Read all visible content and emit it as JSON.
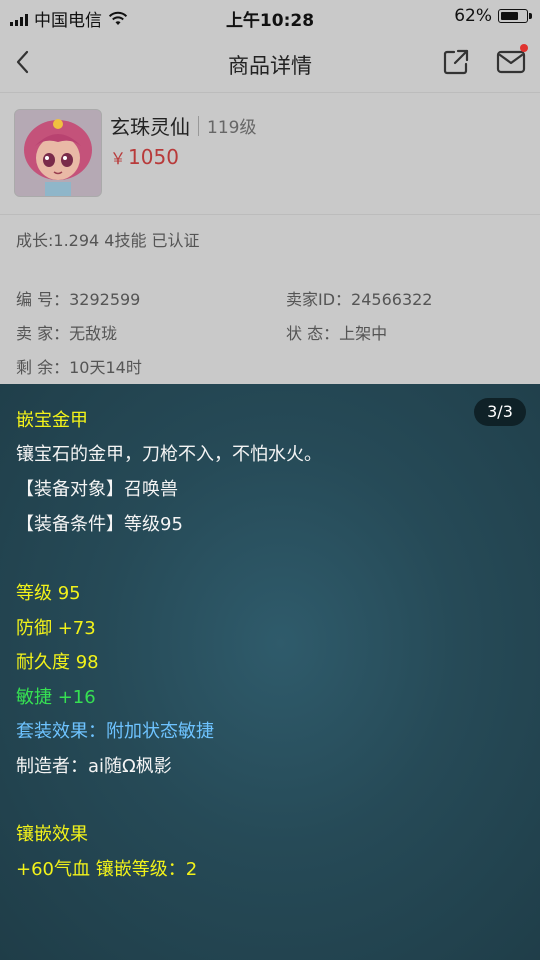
{
  "status_bar": {
    "carrier": "中国电信",
    "time": "上午10:28",
    "battery_percent": "62%",
    "battery_level": 0.62
  },
  "nav": {
    "title": "商品详情",
    "back_icon": "chevron-left-icon",
    "share_icon": "share-icon",
    "mail_icon": "mail-icon"
  },
  "product": {
    "name": "玄珠灵仙",
    "level": "119级",
    "currency": "￥",
    "price": "1050"
  },
  "growth_text": "成长:1.294 4技能 已认证",
  "info": {
    "id_label": "编 号：",
    "id_value": "3292599",
    "seller_id_label": "卖家ID：",
    "seller_id_value": "24566322",
    "seller_label": "卖 家：",
    "seller_value": "无敌珑",
    "status_label": "状 态：",
    "status_value": "上架中",
    "remaining_label": "剩 余：",
    "remaining_value": "10天14时"
  },
  "tooltip": {
    "counter": "3/3",
    "item_name": "嵌宝金甲",
    "description": "镶宝石的金甲，刀枪不入，不怕水火。",
    "equip_target": "【装备对象】召唤兽",
    "equip_condition": "【装备条件】等级95",
    "level": "等级 95",
    "defense": "防御 +73",
    "durability": "耐久度 98",
    "agility": "敏捷 +16",
    "set_effect": "套装效果：附加状态敏捷",
    "maker": "制造者：ai随Ω枫影",
    "inlay_title": "镶嵌效果",
    "inlay_detail": "+60气血 镶嵌等级：2"
  },
  "colors": {
    "price": "#b83a3a",
    "tooltip_bg": "#264a57",
    "yellow_text": "#f2f21a",
    "green_text": "#36e052",
    "blue_text": "#6ec3ff",
    "notification_dot": "#e0332f"
  }
}
